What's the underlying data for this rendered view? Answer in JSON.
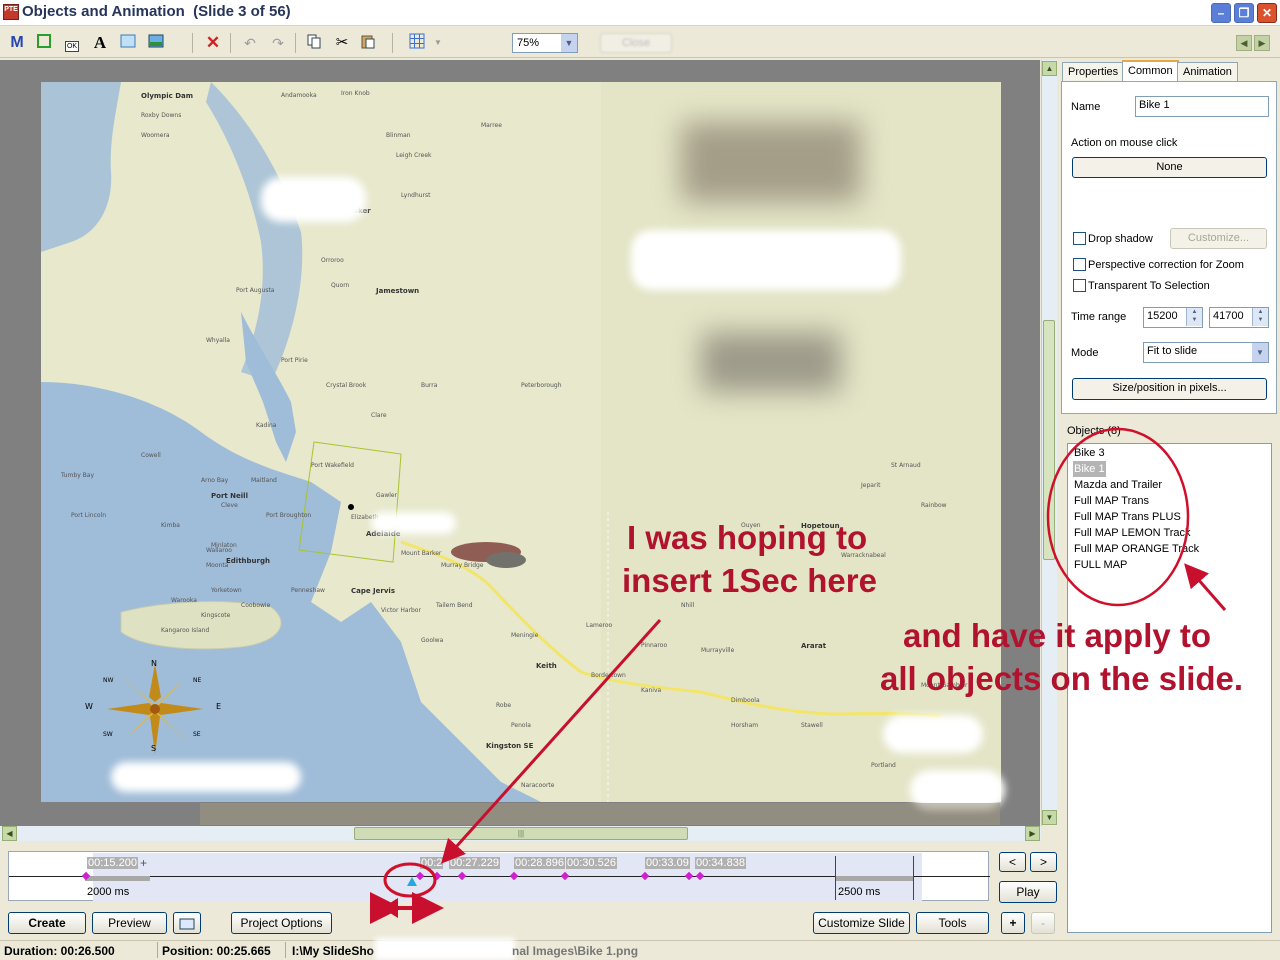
{
  "window": {
    "title": "Objects and Animation  (Slide 3 of 56)",
    "app_icon_label": "PTE"
  },
  "toolbar": {
    "icons": [
      "mask-icon",
      "rectangle-icon",
      "button-icon",
      "text-icon",
      "frame-icon",
      "image-icon",
      "delete-icon",
      "undo-icon",
      "redo-icon",
      "copy-icon",
      "cut-icon",
      "paste-icon",
      "grid-icon"
    ],
    "zoom_value": "75%",
    "close_label": "Close",
    "text_glyph": "A",
    "mask_glyph": "M",
    "button_glyph": "OK"
  },
  "tabs": [
    "Properties",
    "Common",
    "Animation"
  ],
  "common": {
    "name_label": "Name",
    "name_value": "Bike 1",
    "action_label": "Action on mouse click",
    "action_value": "None",
    "drop_shadow_label": "Drop shadow",
    "customize_label": "Customize...",
    "perspective_label": "Perspective correction for Zoom",
    "transparent_label": "Transparent To Selection",
    "time_range_label": "Time range",
    "time_start": "15200",
    "time_end": "41700",
    "mode_label": "Mode",
    "mode_value": "Fit to slide",
    "size_position_label": "Size/position in pixels..."
  },
  "objects": {
    "header": "Objects (8)",
    "items": [
      "Bike 3",
      "Bike 1",
      "Mazda and Trailer",
      "Full MAP Trans",
      "Full MAP Trans PLUS",
      "Full MAP LEMON Track",
      "Full MAP ORANGE Track",
      "FULL MAP"
    ],
    "selected": "Bike 1"
  },
  "timeline": {
    "marks": [
      "00:15.200",
      "00:2",
      "00:27.229",
      "00:28.896",
      "00:30.526",
      "00:33.09",
      "00:34.838"
    ],
    "plus": "+",
    "left_duration": "2000 ms",
    "right_duration": "2500 ms",
    "prev_label": "<",
    "next_label": ">",
    "play_label": "Play"
  },
  "bottom_buttons": {
    "create": "Create",
    "preview": "Preview",
    "project_options": "Project Options",
    "customize_slide": "Customize Slide",
    "tools": "Tools",
    "plus": "+",
    "minus": "-"
  },
  "status": {
    "duration": "Duration:  00:26.500",
    "position": "Position:  00:25.665",
    "path_start": "I:\\My SlideSho",
    "path_end": "nal Images\\Bike 1.png"
  },
  "annotations": {
    "line1": "I was hoping to",
    "line2": "insert 1Sec here",
    "line3": "and have it apply to",
    "line4": "all objects on the slide."
  },
  "map": {
    "places": [
      "Olympic Dam",
      "Roxby Downs",
      "Woomera",
      "Iron Knob",
      "Port Augusta",
      "Whyalla",
      "Port Pirie",
      "Jamestown",
      "Crystal Brook",
      "Clare",
      "Kadina",
      "Port Wakefield",
      "Gawler",
      "Elizabeth",
      "Adelaide",
      "Mount Barker",
      "Murray Bridge",
      "Tailem Bend",
      "Victor Harbor",
      "Kingscote",
      "Kangaroo Island",
      "Keith",
      "Bordertown",
      "Kaniva",
      "Nhill",
      "Dimboola",
      "Horsham",
      "Stawell",
      "Ararat",
      "Hamilton",
      "Portland",
      "Mount Gambier",
      "Naracoorte",
      "Penola",
      "Robe",
      "Kingston SE",
      "Port Lincoln",
      "Tumby Bay",
      "Cowell",
      "Arno Bay",
      "Cleve",
      "Kimba",
      "Edithburgh",
      "Minlaton",
      "Maitland",
      "Port Broughton",
      "Burra",
      "Peterborough",
      "Orroroo",
      "Hawker",
      "Quorn",
      "Blinman",
      "Leigh Creek",
      "Lyndhurst",
      "Marree",
      "Andamooka",
      "Port Neill",
      "Wallaroo",
      "Moonta",
      "Yorketown",
      "Warooka",
      "Coobowie",
      "Penneshaw",
      "Cape Jervis",
      "Goolwa",
      "Meningie",
      "Lameroo",
      "Pinnaroo",
      "Murrayville",
      "Ouyen",
      "Hopetoun",
      "Warracknabeal",
      "Jeparit",
      "Rainbow",
      "St Arnaud"
    ],
    "compass": [
      "N",
      "NE",
      "E",
      "SE",
      "S",
      "SW",
      "W",
      "NW"
    ]
  },
  "colors": {
    "annotation_red": "#b1122e",
    "title_blue": "#27355b",
    "keyframe": "#d020d0",
    "map_water": "#9fbcd8",
    "map_land": "#e7e8cc"
  }
}
